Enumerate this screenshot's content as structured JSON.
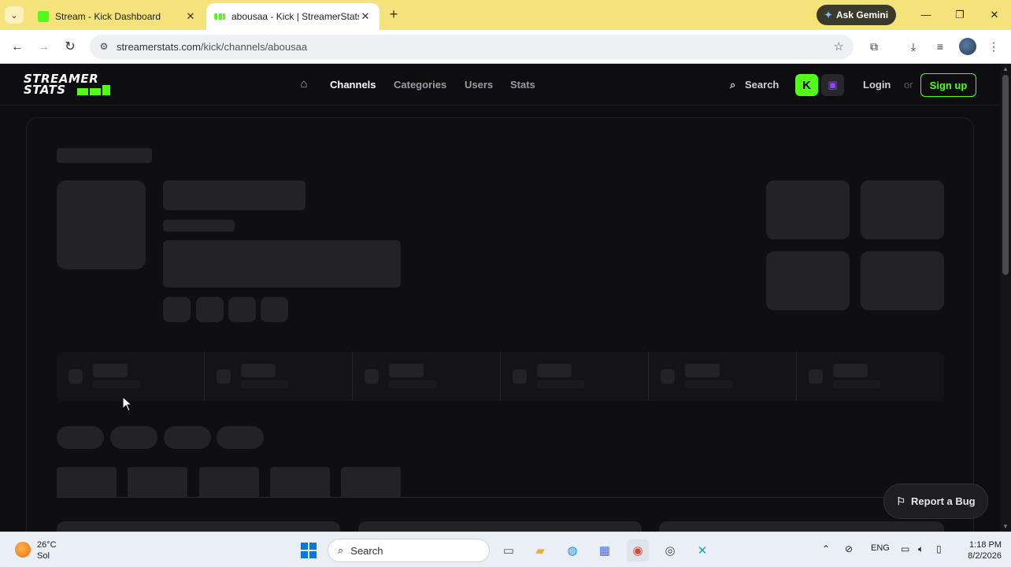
{
  "browser": {
    "tabs": [
      {
        "title": "Stream - Kick Dashboard",
        "favicon_color": "#53fc18"
      },
      {
        "title": "abousaa - Kick | StreamerStats",
        "favicon_color": "#53fc18"
      }
    ],
    "gemini_label": "Ask Gemini",
    "url_host": "streamerstats.com",
    "url_path": "/kick/channels/abousaa"
  },
  "site": {
    "logo_line1": "STREAMER",
    "logo_line2": "STATS",
    "nav_links": [
      "Channels",
      "Categories",
      "Users",
      "Stats"
    ],
    "search_label": "Search",
    "login_label": "Login",
    "or_label": "or",
    "signup_label": "Sign up",
    "report_bug_label": "Report a Bug",
    "accent_color": "#53fc18"
  },
  "taskbar": {
    "temperature": "26°C",
    "weather": "Sol",
    "search_placeholder": "Search",
    "language": "ENG",
    "time": "1:18 PM",
    "date": "8/2/2026"
  }
}
